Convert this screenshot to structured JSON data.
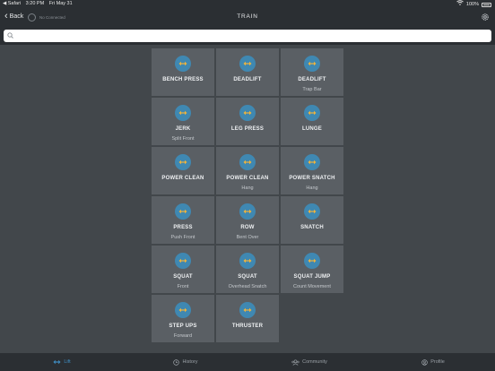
{
  "status": {
    "carrier": "◀ Safari",
    "time": "3:20 PM",
    "date": "Fri May 31",
    "battery": "100%"
  },
  "nav": {
    "back_label": "Back",
    "connection": "No Connected",
    "title": "TRAIN"
  },
  "search": {
    "value": "",
    "placeholder": ""
  },
  "colors": {
    "accent": "#3f8fc4",
    "tile": "#5a5f64",
    "icon_circle": "#3f88b2",
    "icon_arrow": "#f0b43c"
  },
  "exercises": [
    {
      "name": "BENCH PRESS",
      "sub": ""
    },
    {
      "name": "DEADLIFT",
      "sub": ""
    },
    {
      "name": "DEADLIFT",
      "sub": "Trap Bar"
    },
    {
      "name": "JERK",
      "sub": "Split Front"
    },
    {
      "name": "LEG PRESS",
      "sub": ""
    },
    {
      "name": "LUNGE",
      "sub": ""
    },
    {
      "name": "POWER CLEAN",
      "sub": ""
    },
    {
      "name": "POWER CLEAN",
      "sub": "Hang"
    },
    {
      "name": "POWER SNATCH",
      "sub": "Hang"
    },
    {
      "name": "PRESS",
      "sub": "Push Front"
    },
    {
      "name": "ROW",
      "sub": "Bent Over"
    },
    {
      "name": "SNATCH",
      "sub": ""
    },
    {
      "name": "SQUAT",
      "sub": "Front"
    },
    {
      "name": "SQUAT",
      "sub": "Overhead Snatch"
    },
    {
      "name": "SQUAT JUMP",
      "sub": "Count Movement"
    },
    {
      "name": "STEP UPS",
      "sub": "Forward"
    },
    {
      "name": "THRUSTER",
      "sub": ""
    }
  ],
  "tabs": [
    {
      "label": "Lift",
      "icon": "barbell-icon",
      "active": true
    },
    {
      "label": "History",
      "icon": "clock-icon",
      "active": false
    },
    {
      "label": "Community",
      "icon": "group-icon",
      "active": false
    },
    {
      "label": "Profile",
      "icon": "profile-icon",
      "active": false
    }
  ]
}
